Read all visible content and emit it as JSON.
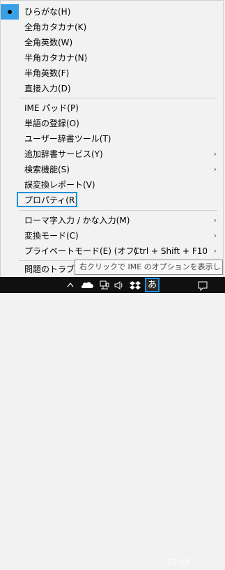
{
  "menu": {
    "items": [
      {
        "label": "ひらがな(H)"
      },
      {
        "label": "全角カタカナ(K)"
      },
      {
        "label": "全角英数(W)"
      },
      {
        "label": "半角カタカナ(N)"
      },
      {
        "label": "半角英数(F)"
      },
      {
        "label": "直接入力(D)"
      },
      {
        "label": "IME パッド(P)"
      },
      {
        "label": "単語の登録(O)"
      },
      {
        "label": "ユーザー辞書ツール(T)"
      },
      {
        "label": "追加辞書サービス(Y)"
      },
      {
        "label": "検索機能(S)"
      },
      {
        "label": "誤変換レポート(V)"
      },
      {
        "label": "プロパティ(R)"
      },
      {
        "label": "ローマ字入力 / かな入力(M)"
      },
      {
        "label": "変換モード(C)"
      },
      {
        "label": "プライベートモード(E) (オフ)",
        "shortcut": "Ctrl + Shift + F10"
      },
      {
        "label": "問題のトラブル"
      }
    ],
    "submenu_arrow": "›"
  },
  "tooltip": {
    "text": "右クリックで IME のオプションを表示します。"
  },
  "taskbar": {
    "ime_indicator": "あ",
    "clock": "12:52",
    "icons": [
      "chevron-up-icon",
      "onedrive-cloud-icon",
      "network-icon",
      "volume-icon",
      "dropbox-icon",
      "ime-mode-icon",
      "notification-icon"
    ]
  },
  "colors": {
    "accent": "#1e90d8",
    "selected": "#3aa0e6",
    "menu_bg": "#f2f2f2",
    "taskbar_bg": "#101010"
  }
}
